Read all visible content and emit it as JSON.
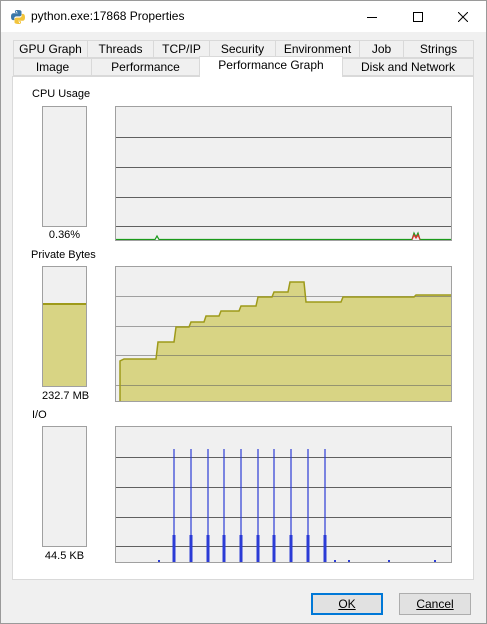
{
  "window": {
    "title": "python.exe:17868 Properties"
  },
  "tabs_row1": [
    "GPU Graph",
    "Threads",
    "TCP/IP",
    "Security",
    "Environment",
    "Job",
    "Strings"
  ],
  "tabs_row2": [
    "Image",
    "Performance",
    "Performance Graph",
    "Disk and Network"
  ],
  "active_tab": "Performance Graph",
  "graphs": {
    "cpu": {
      "label": "CPU Usage",
      "value": "0.36%",
      "meter_fraction": 0.0036
    },
    "private_bytes": {
      "label": "Private Bytes",
      "value": "232.7 MB",
      "meter_fraction": 0.7
    },
    "io": {
      "label": "I/O",
      "value": "44.5  KB",
      "meter_fraction": 0.0
    }
  },
  "buttons": {
    "ok": "OK",
    "cancel": "Cancel"
  },
  "colors": {
    "fill": "#d8d484",
    "line": "#9e9a1a",
    "io_line": "#2b3bd6",
    "cpu_green": "#1a9a1a",
    "cpu_red": "#e03030",
    "grid": "#606060"
  }
}
